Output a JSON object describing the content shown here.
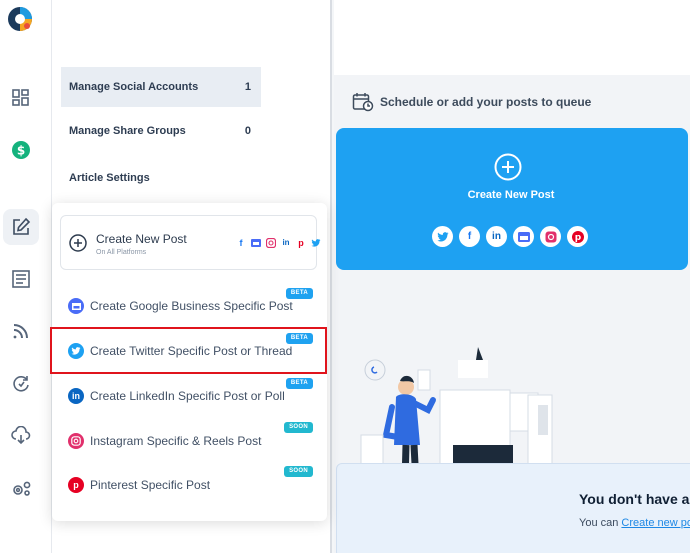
{
  "menu": {
    "items": [
      {
        "label": "Manage Social Accounts",
        "count": "1"
      },
      {
        "label": "Manage Share Groups",
        "count": "0"
      },
      {
        "label": "Article Settings",
        "count": ""
      }
    ]
  },
  "dropdown": {
    "create_new_post": {
      "title": "Create New Post",
      "subtitle": "On All Platforms",
      "icons": [
        "facebook-icon",
        "google-business-icon",
        "instagram-icon",
        "linkedin-icon",
        "pinterest-icon",
        "twitter-icon"
      ]
    },
    "items": [
      {
        "label": "Create Google Business Specific Post",
        "badge": "BETA",
        "icon": "google-business-icon",
        "color": "#4a6cf7"
      },
      {
        "label": "Create Twitter Specific Post or Thread",
        "badge": "BETA",
        "icon": "twitter-icon",
        "color": "#1da1f2"
      },
      {
        "label": "Create LinkedIn Specific Post or Poll",
        "badge": "BETA",
        "icon": "linkedin-icon",
        "color": "#0a66c2"
      },
      {
        "label": "Instagram Specific & Reels Post",
        "badge": "SOON",
        "icon": "instagram-icon",
        "color": "#e1306c"
      },
      {
        "label": "Pinterest Specific Post",
        "badge": "SOON",
        "icon": "pinterest-icon",
        "color": "#e60023"
      }
    ]
  },
  "main": {
    "heading": "Schedule or add your posts to queue",
    "create_card": {
      "label": "Create New Post",
      "socials": [
        "twitter-icon",
        "facebook-icon",
        "linkedin-icon",
        "google-business-icon",
        "instagram-icon",
        "pinterest-icon"
      ]
    },
    "empty_state": {
      "title": "You don't have ar",
      "text_prefix": "You can ",
      "link": "Create new po"
    }
  },
  "colors": {
    "accent_blue": "#1ea1f2",
    "highlight_red": "#e0141c",
    "badge_beta": "#1fa2f0",
    "badge_soon": "#22b8cf"
  }
}
